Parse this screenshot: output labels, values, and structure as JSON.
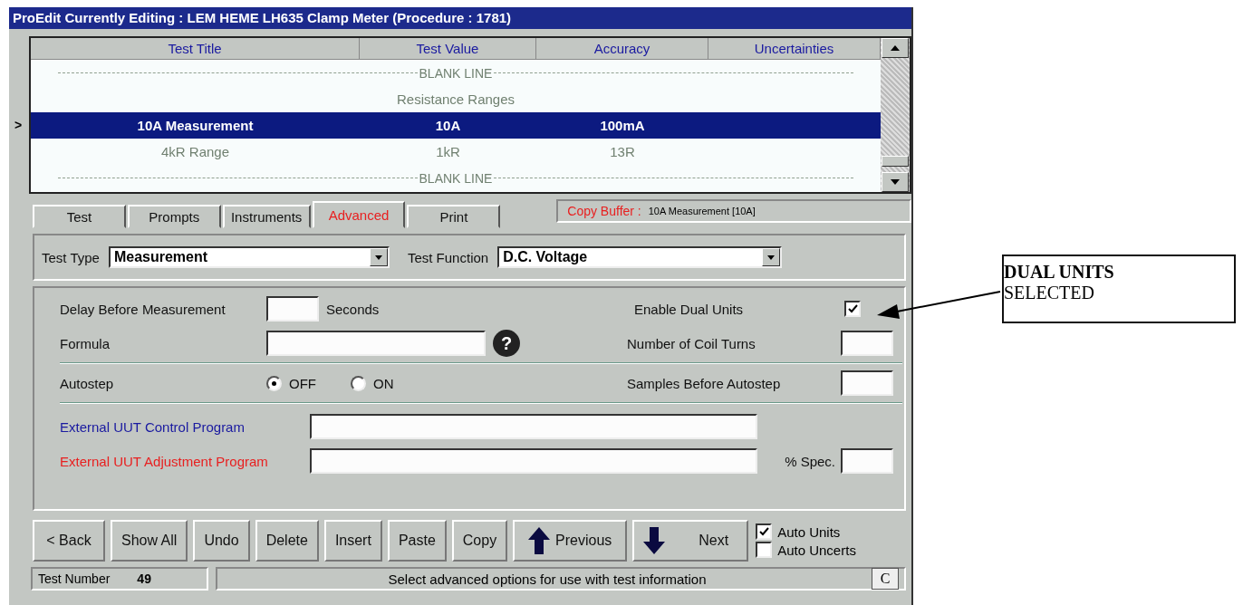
{
  "window": {
    "title": "ProEdit Currently Editing : LEM HEME LH635 Clamp Meter (Procedure : 1781)"
  },
  "table": {
    "columns": [
      "Test Title",
      "Test Value",
      "Accuracy",
      "Uncertainties"
    ],
    "pointer": ">",
    "rows": [
      {
        "kind": "blank",
        "text": "BLANK LINE",
        "selected": false
      },
      {
        "kind": "heading",
        "text": "Resistance Ranges",
        "selected": false
      },
      {
        "kind": "test",
        "cells": [
          "10A Measurement",
          "10A",
          "100mA"
        ],
        "selected": true
      },
      {
        "kind": "test",
        "cells": [
          "4kR Range",
          "1kR",
          "13R"
        ],
        "selected": false
      },
      {
        "kind": "blank",
        "text": "BLANK LINE",
        "selected": false
      }
    ]
  },
  "tabs": [
    {
      "label": "Test",
      "selected": false
    },
    {
      "label": "Prompts",
      "selected": false
    },
    {
      "label": "Instruments",
      "selected": false
    },
    {
      "label": "Advanced",
      "selected": true
    },
    {
      "label": "Print",
      "selected": false
    }
  ],
  "copy_buffer": {
    "label": "Copy Buffer :",
    "value": "10A Measurement  [10A]"
  },
  "test_type": {
    "label": "Test Type",
    "value": "Measurement"
  },
  "test_function": {
    "label": "Test Function",
    "value": "D.C. Voltage"
  },
  "advanced": {
    "delay": {
      "label": "Delay Before Measurement",
      "unit": "Seconds"
    },
    "formula": {
      "label": "Formula",
      "help": "?"
    },
    "dual_units": {
      "label": "Enable Dual Units",
      "checked": true
    },
    "coil_turns": {
      "label": "Number of Coil Turns"
    },
    "autostep": {
      "label": "Autostep",
      "options": [
        {
          "label": "OFF",
          "selected": true
        },
        {
          "label": "ON",
          "selected": false
        }
      ]
    },
    "samples": {
      "label": "Samples Before Autostep"
    },
    "programs": [
      {
        "label": "External UUT Control Program",
        "color": "#1a1aa0"
      },
      {
        "label": "External UUT Adjustment Program",
        "color": "#e82020"
      }
    ],
    "spec": {
      "label": "% Spec."
    }
  },
  "buttons": [
    {
      "label": "Back",
      "kind": "back",
      "prefix": "<"
    },
    {
      "label": "Show All",
      "kind": "plain"
    },
    {
      "label": "Undo",
      "kind": "plain"
    },
    {
      "label": "Delete",
      "kind": "plain"
    },
    {
      "label": "Insert",
      "kind": "plain"
    },
    {
      "label": "Paste",
      "kind": "plain"
    },
    {
      "label": "Copy",
      "kind": "plain"
    },
    {
      "label": "Previous",
      "kind": "up"
    },
    {
      "label": "Next",
      "kind": "down"
    }
  ],
  "options": [
    {
      "label": "Auto Units",
      "checked": true
    },
    {
      "label": "Auto Uncerts",
      "checked": false
    }
  ],
  "status_bar": {
    "label": "Test Number",
    "value": "49",
    "message": "Select advanced options for use with test information",
    "corner": "C"
  },
  "callout": {
    "title": "DUAL UNITS",
    "text": "SELECTED"
  }
}
